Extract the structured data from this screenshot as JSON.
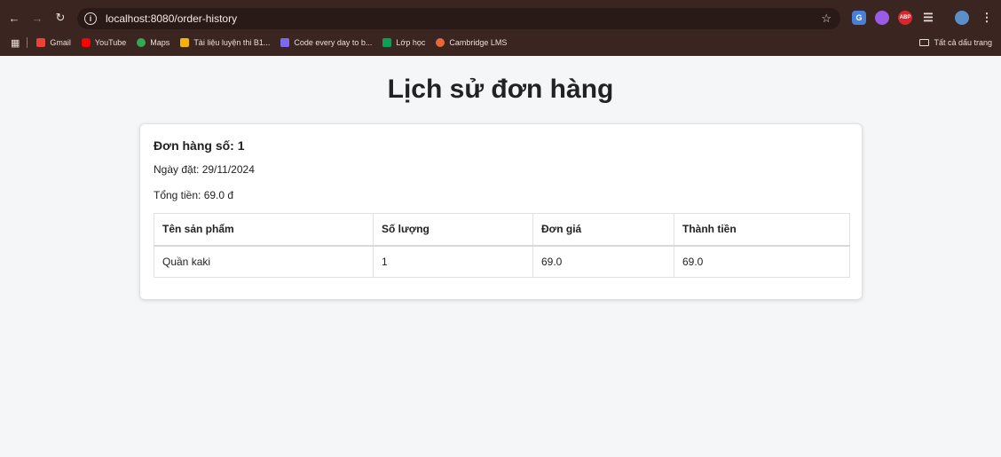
{
  "browser": {
    "url": "localhost:8080/order-history",
    "bookmarks": [
      {
        "label": "Gmail",
        "color": "#ea4335"
      },
      {
        "label": "YouTube",
        "color": "#ff0000"
      },
      {
        "label": "Maps",
        "color": "#34a853"
      },
      {
        "label": "Tài liệu luyện thi B1...",
        "color": "#f4b400"
      },
      {
        "label": "Code every day to b...",
        "color": "#7b68ee"
      },
      {
        "label": "Lớp học",
        "color": "#0f9d58"
      },
      {
        "label": "Cambridge LMS",
        "color": "#e8663d"
      }
    ],
    "all_bookmarks_label": "Tất cả dấu trang"
  },
  "page": {
    "title": "Lịch sử đơn hàng",
    "order": {
      "heading": "Đơn hàng số: 1",
      "date": "Ngày đặt: 29/11/2024",
      "total": "Tổng tiền: 69.0 đ",
      "columns": [
        "Tên sản phẩm",
        "Số lượng",
        "Đơn giá",
        "Thành tiền"
      ],
      "rows": [
        [
          "Quần kaki",
          "1",
          "69.0",
          "69.0"
        ]
      ]
    }
  }
}
